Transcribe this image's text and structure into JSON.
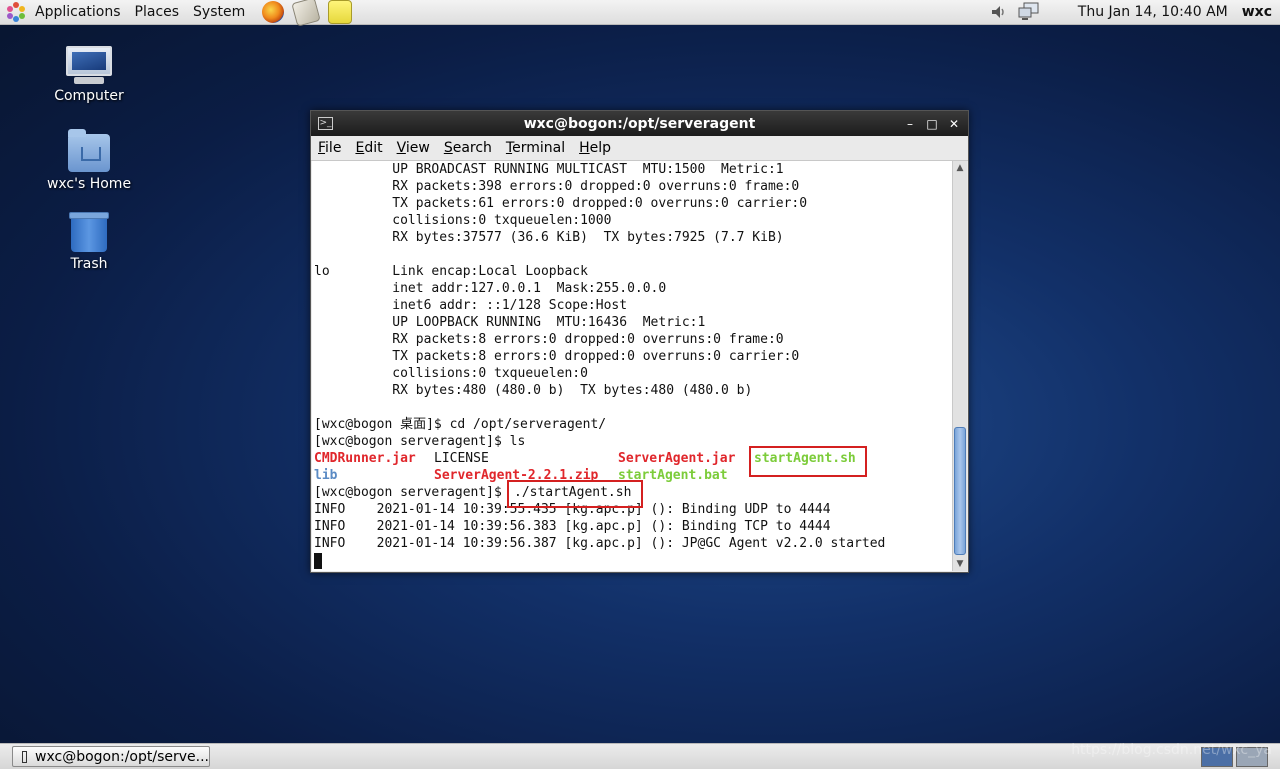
{
  "top_panel": {
    "menus": [
      "Applications",
      "Places",
      "System"
    ],
    "clock": "Thu Jan 14, 10:40 AM",
    "user": "wxc"
  },
  "desktop_icons": [
    {
      "label": "Computer"
    },
    {
      "label": "wxc's Home"
    },
    {
      "label": "Trash"
    }
  ],
  "terminal": {
    "title": "wxc@bogon:/opt/serveragent",
    "menus": [
      {
        "accel": "F",
        "rest": "ile"
      },
      {
        "accel": "E",
        "rest": "dit"
      },
      {
        "accel": "V",
        "rest": "iew"
      },
      {
        "accel": "S",
        "rest": "earch"
      },
      {
        "accel": "T",
        "rest": "erminal"
      },
      {
        "accel": "H",
        "rest": "elp"
      }
    ],
    "lines": [
      "          UP BROADCAST RUNNING MULTICAST  MTU:1500  Metric:1",
      "          RX packets:398 errors:0 dropped:0 overruns:0 frame:0",
      "          TX packets:61 errors:0 dropped:0 overruns:0 carrier:0",
      "          collisions:0 txqueuelen:1000",
      "          RX bytes:37577 (36.6 KiB)  TX bytes:7925 (7.7 KiB)",
      "",
      "lo        Link encap:Local Loopback",
      "          inet addr:127.0.0.1  Mask:255.0.0.0",
      "          inet6 addr: ::1/128 Scope:Host",
      "          UP LOOPBACK RUNNING  MTU:16436  Metric:1",
      "          RX packets:8 errors:0 dropped:0 overruns:0 frame:0",
      "          TX packets:8 errors:0 dropped:0 overruns:0 carrier:0",
      "          collisions:0 txqueuelen:0",
      "          RX bytes:480 (480.0 b)  TX bytes:480 (480.0 b)",
      "",
      "[wxc@bogon 桌面]$ cd /opt/serveragent/",
      "[wxc@bogon serveragent]$ ls"
    ],
    "ls_row1": {
      "a": "CMDRunner.jar",
      "b": "LICENSE",
      "c": "ServerAgent.jar",
      "d": "startAgent.sh"
    },
    "ls_row2": {
      "a": "lib",
      "b": "ServerAgent-2.2.1.zip",
      "c": "startAgent.bat"
    },
    "prompt": "[wxc@bogon serveragent]$ ",
    "command": "./startAgent.sh",
    "log_lines": [
      "INFO    2021-01-14 10:39:55.435 [kg.apc.p] (): Binding UDP to 4444",
      "INFO    2021-01-14 10:39:56.383 [kg.apc.p] (): Binding TCP to 4444",
      "INFO    2021-01-14 10:39:56.387 [kg.apc.p] (): JP@GC Agent v2.2.0 started"
    ],
    "colors": {
      "red": "#e0262b",
      "blue": "#5b8bc4",
      "green": "#7ccc3a",
      "highlight": "#d42020"
    }
  },
  "taskbar": {
    "task_label": "wxc@bogon:/opt/serve..."
  },
  "watermark": "https://blog.csdn.net/wxc_ya"
}
